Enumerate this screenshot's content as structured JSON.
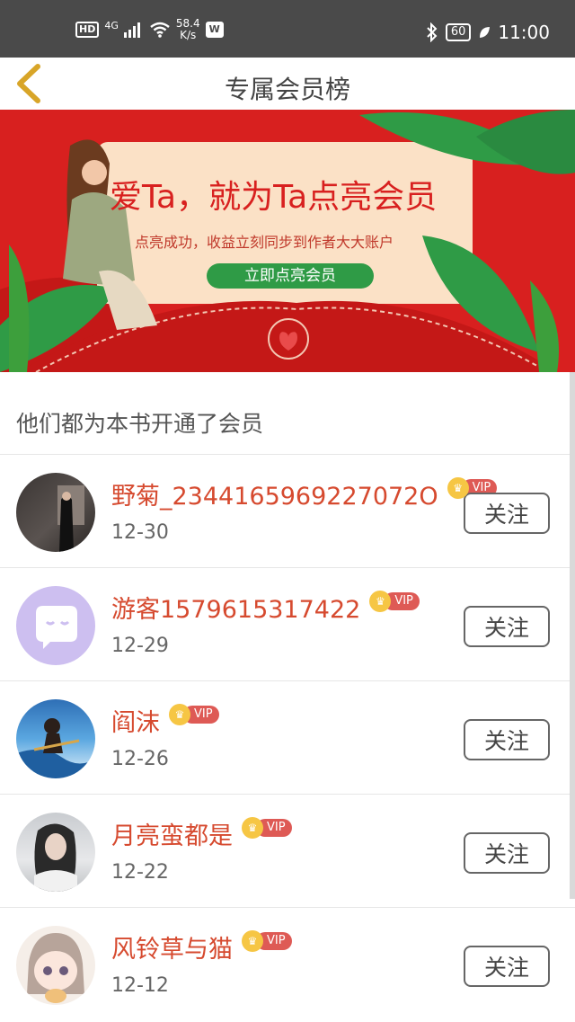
{
  "status_bar": {
    "hd": "HD",
    "network": "4G",
    "speed_value": "58.4",
    "speed_unit": "K/s",
    "app_badge": "W",
    "battery": "60",
    "time": "11:00",
    "icons": [
      "hd-icon",
      "signal-icon",
      "wifi-icon",
      "wps-icon",
      "bluetooth-icon",
      "battery-icon",
      "leaf-icon"
    ]
  },
  "header": {
    "title": "专属会员榜",
    "back_icon": "chevron-left-icon"
  },
  "banner": {
    "headline": "爱Ta，就为Ta点亮会员",
    "subline": "点亮成功，收益立刻同步到作者大大账户",
    "cta": "立即点亮会员",
    "colors": {
      "background": "#d8201f",
      "card": "#fbe1c6",
      "cta": "#2f9b46"
    }
  },
  "section": {
    "title": "他们都为本书开通了会员"
  },
  "members": [
    {
      "name": "野菊_2344165969227072O",
      "date": "12-30",
      "badge": "VIP",
      "follow_label": "关注",
      "avatar": "photo-woman-dark"
    },
    {
      "name": "游客1579615317422",
      "date": "12-29",
      "badge": "VIP",
      "follow_label": "关注",
      "avatar": "default-chat-avatar"
    },
    {
      "name": "阎沫",
      "date": "12-26",
      "badge": "VIP",
      "follow_label": "关注",
      "avatar": "anime-sky"
    },
    {
      "name": "月亮蛮都是",
      "date": "12-22",
      "badge": "VIP",
      "follow_label": "关注",
      "avatar": "photo-girl"
    },
    {
      "name": "风铃草与猫",
      "date": "12-12",
      "badge": "VIP",
      "follow_label": "关注",
      "avatar": "anime-girl"
    }
  ],
  "accent_colors": {
    "name": "#d64a2f",
    "vip": "#de5a55",
    "crown": "#f6c644"
  }
}
